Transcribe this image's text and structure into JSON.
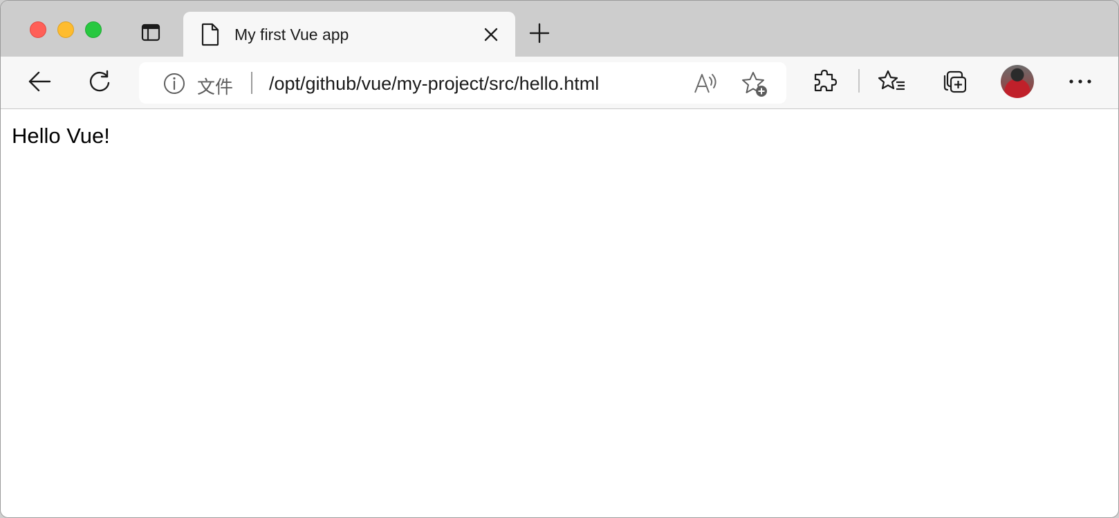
{
  "window": {
    "traffic_lights": [
      "close",
      "minimize",
      "maximize"
    ],
    "colors": {
      "close": "#ff5f57",
      "minimize": "#febc2e",
      "maximize": "#28c840"
    }
  },
  "tab": {
    "title": "My first Vue app",
    "icon": "page-icon"
  },
  "addressbar": {
    "scheme_label": "文件",
    "url": "/opt/github/vue/my-project/src/hello.html"
  },
  "toolbar": {
    "icons": [
      "back-icon",
      "reload-icon",
      "info-icon",
      "read-aloud-icon",
      "add-favorite-icon",
      "extensions-icon",
      "favorites-icon",
      "collections-icon",
      "avatar",
      "more-icon"
    ]
  },
  "page": {
    "text": "Hello Vue!"
  }
}
